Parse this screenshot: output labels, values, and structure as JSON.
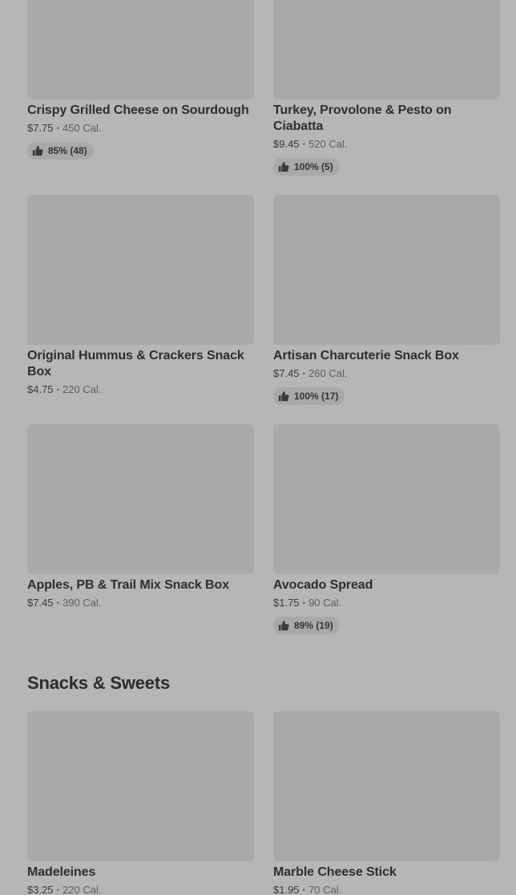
{
  "items": [
    {
      "name": "Crispy Grilled Cheese on Sourdough",
      "price": "$7.75",
      "cal": "450 Cal.",
      "rating": "85% (48)"
    },
    {
      "name": "Turkey, Provolone & Pesto on Ciabatta",
      "price": "$9.45",
      "cal": "520 Cal.",
      "rating": "100% (5)"
    },
    {
      "name": "Original Hummus & Crackers Snack Box",
      "price": "$4.75",
      "cal": "220 Cal.",
      "rating": null
    },
    {
      "name": "Artisan Charcuterie Snack Box",
      "price": "$7.45",
      "cal": "260 Cal.",
      "rating": "100% (17)"
    },
    {
      "name": "Apples, PB & Trail Mix Snack Box",
      "price": "$7.45",
      "cal": "390 Cal.",
      "rating": null
    },
    {
      "name": "Avocado Spread",
      "price": "$1.75",
      "cal": "90 Cal.",
      "rating": "89% (19)"
    }
  ],
  "section": {
    "title": "Snacks & Sweets",
    "items": [
      {
        "name": "Madeleines",
        "price": "$3.25",
        "cal": "220 Cal."
      },
      {
        "name": "Marble Cheese Stick",
        "price": "$1.95",
        "cal": "70 Cal."
      }
    ]
  },
  "separator": "•",
  "icons": {
    "rating": "thumbs-up-icon"
  }
}
